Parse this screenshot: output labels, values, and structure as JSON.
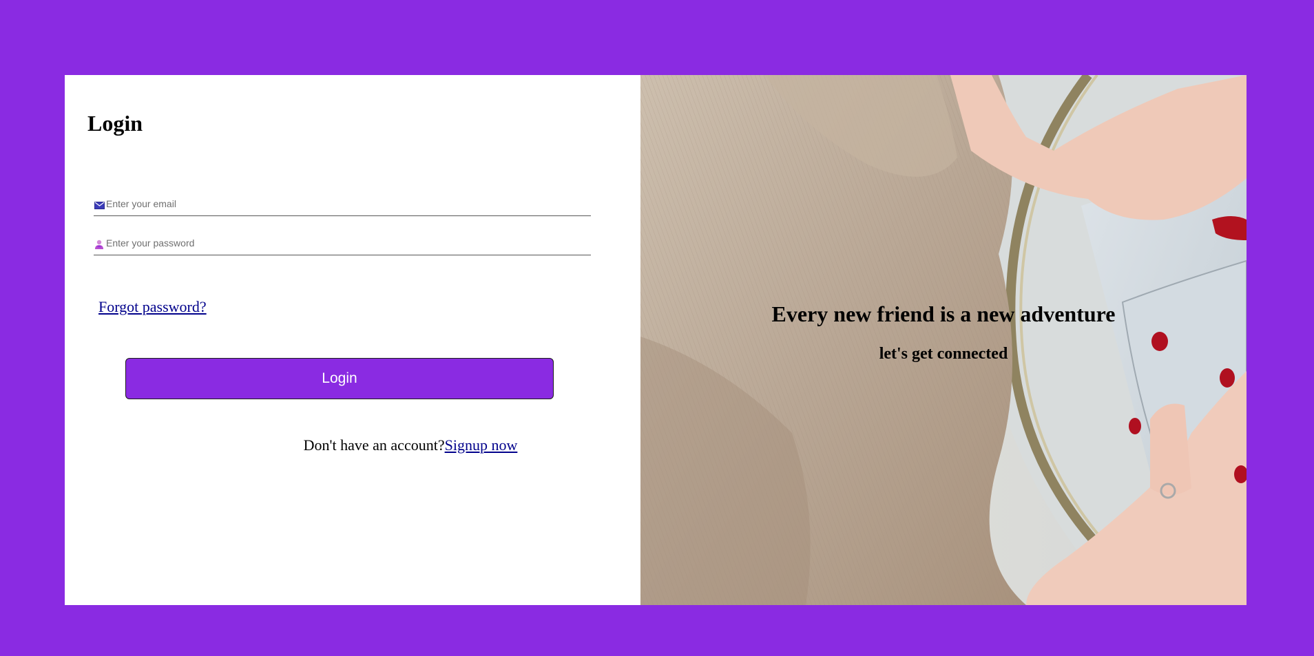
{
  "login": {
    "title": "Login",
    "email": {
      "placeholder": "Enter your email",
      "value": "",
      "icon": "envelope-icon"
    },
    "password": {
      "placeholder": "Enter your password",
      "value": "",
      "icon": "user-icon"
    },
    "forgot_label": "Forgot password?",
    "submit_label": "Login",
    "no_account_text": "Don't have an account?",
    "signup_label": "Signup now"
  },
  "hero": {
    "headline": "Every new friend is a new adventure",
    "subline": "let's get connected"
  },
  "colors": {
    "background": "#8a2be2",
    "button": "#8a2be2",
    "link": "#00008b"
  }
}
